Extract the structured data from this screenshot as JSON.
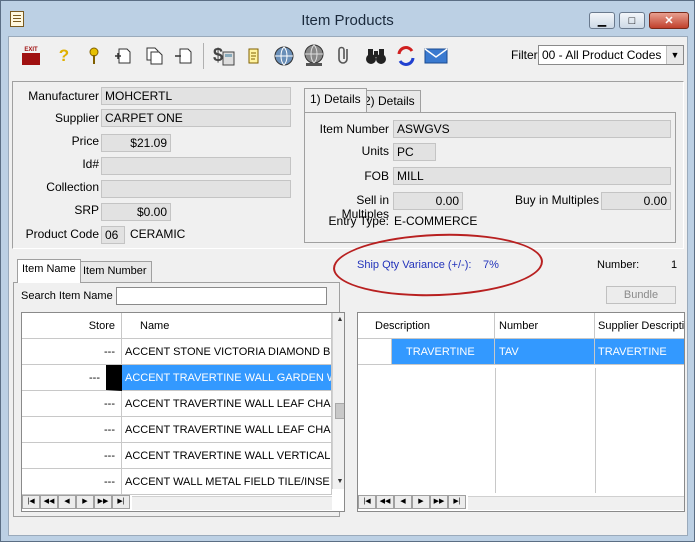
{
  "window": {
    "title": "Item Products",
    "minimize_glyph": "▁",
    "maximize_glyph": "□",
    "close_glyph": "✕"
  },
  "toolbar": {
    "icons": [
      "exit-icon",
      "help-icon",
      "keys-icon",
      "add-item-icon",
      "copy-item-icon",
      "delete-item-icon",
      "pricing-icon",
      "notes-icon",
      "globe-icon",
      "attach-icon",
      "binoculars-icon",
      "refresh-icon",
      "email-icon"
    ],
    "exit_label": "EXIT",
    "filter_label": "Filter",
    "filter_value": "00 - All Product Codes"
  },
  "header": {
    "manufacturer_label": "Manufacturer",
    "manufacturer_value": "MOHCERTL",
    "supplier_label": "Supplier",
    "supplier_value": "CARPET ONE",
    "price_label": "Price",
    "price_value": "$21.09",
    "id_label": "Id#",
    "id_value": "",
    "collection_label": "Collection",
    "collection_value": "",
    "srp_label": "SRP",
    "srp_value": "$0.00",
    "product_code_label": "Product Code",
    "product_code_num": "06",
    "product_code_name": "CERAMIC"
  },
  "details": {
    "tabs": [
      "1) Details",
      "2) Details"
    ],
    "item_number_label": "Item Number",
    "item_number_value": "ASWGVS",
    "units_label": "Units",
    "units_value": "PC",
    "fob_label": "FOB",
    "fob_value": "MILL",
    "sell_multiples_label": "Sell in Multiples",
    "sell_multiples_value": "0.00",
    "buy_multiples_label": "Buy in Multiples",
    "buy_multiples_value": "0.00",
    "entry_type_label": "Entry Type:",
    "entry_type_value": "E-COMMERCE"
  },
  "variance": {
    "label": "Ship Qty Variance (+/-):",
    "value": "7%"
  },
  "number": {
    "label": "Number:",
    "value": "1"
  },
  "left": {
    "tabs": [
      "Item Name",
      "Item Number"
    ],
    "search_label": "Search Item Name",
    "search_value": "",
    "columns": [
      "Store",
      "Name"
    ],
    "rows": [
      {
        "store": "---",
        "name": "ACCENT STONE VICTORIA DIAMOND BL"
      },
      {
        "store": "---",
        "name": "ACCENT TRAVERTINE WALL GARDEN W"
      },
      {
        "store": "---",
        "name": "ACCENT TRAVERTINE WALL LEAF CHA"
      },
      {
        "store": "---",
        "name": "ACCENT TRAVERTINE WALL LEAF CHA"
      },
      {
        "store": "---",
        "name": "ACCENT TRAVERTINE WALL VERTICAL"
      },
      {
        "store": "---",
        "name": "ACCENT WALL METAL FIELD TILE/INSE"
      }
    ],
    "selected_index": 1
  },
  "right": {
    "bundle_label": "Bundle",
    "columns": [
      "Description",
      "Number",
      "Supplier Descripti"
    ],
    "rows": [
      {
        "description": "TRAVERTINE",
        "number": "TAV",
        "supplier_desc": "TRAVERTINE"
      }
    ]
  },
  "nav_buttons": [
    "|◀",
    "◀◀",
    "◀",
    "▶",
    "▶▶",
    "▶|"
  ]
}
